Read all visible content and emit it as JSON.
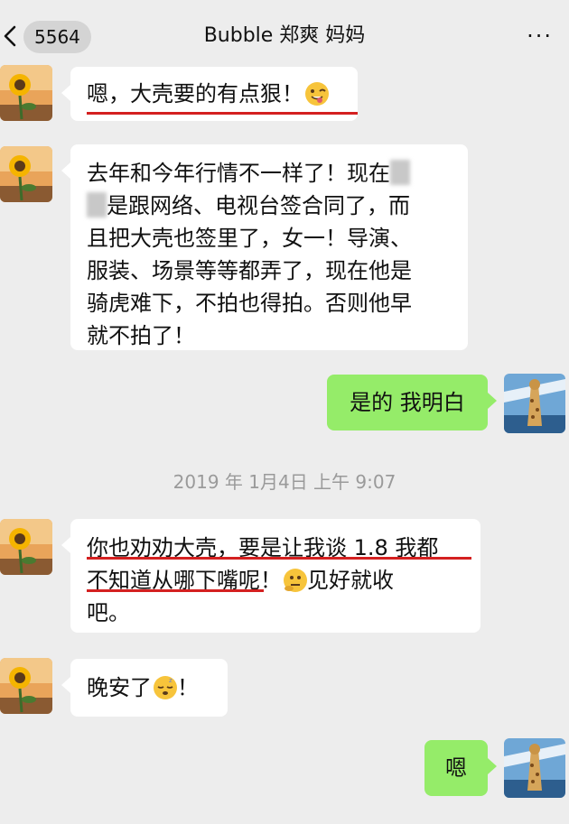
{
  "header": {
    "back_badge": "5564",
    "title": "Bubble 郑爽 妈妈",
    "more_label": "···"
  },
  "icons": {
    "back": "chevron-left-icon",
    "more": "more-dots-icon",
    "contact_avatar": "sunflower-avatar",
    "my_avatar": "giraffe-avatar"
  },
  "colors": {
    "background": "#ededed",
    "incoming_bubble": "#ffffff",
    "outgoing_bubble": "#95ec69",
    "annotation_red": "#d42020"
  },
  "messages": [
    {
      "side": "left",
      "line1": "嗯，大壳要的有点狠！",
      "emoji": "winking-face-tongue"
    },
    {
      "side": "left",
      "line1": "去年和今年行情不一样了！现在",
      "line2": "是跟网络、电视台签合同了，而",
      "line3": "且把大壳也签里了，女一！导演、",
      "line4": "服装、场景等等都弄了，现在他是",
      "line5": "骑虎难下，不拍也得拍。否则他早",
      "line6": "就不拍了！"
    },
    {
      "side": "right",
      "line1": "是的 我明白"
    },
    {
      "side": "left",
      "line1": "你也劝劝大壳，要是让我谈 1.8 我都",
      "line2a": "不知道从哪下嘴呢！",
      "line2b": "见好就收",
      "line3": "吧。",
      "emoji": "thinking-face"
    },
    {
      "side": "left",
      "line1a": "晚安了",
      "line1b": "！",
      "emoji": "sleeping-face"
    },
    {
      "side": "right",
      "line1": "嗯"
    }
  ],
  "timestamp": "2019 年 1月4日 上午 9:07"
}
